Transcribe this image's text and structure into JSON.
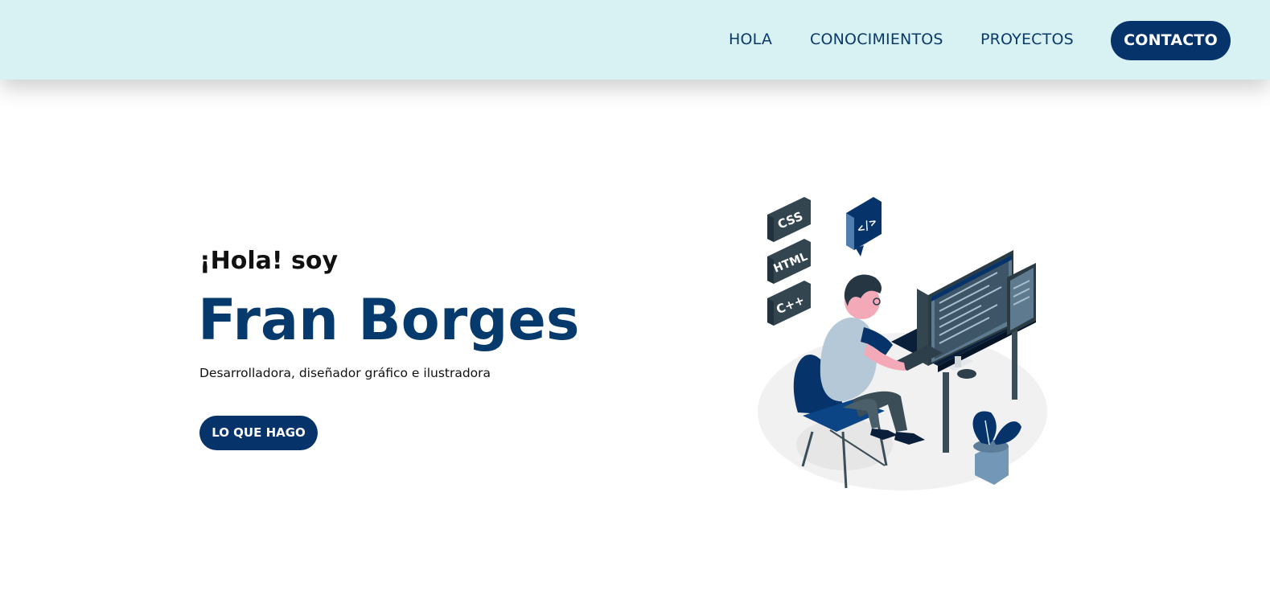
{
  "nav": {
    "links": [
      "HOLA",
      "CONOCIMIENTOS",
      "PROYECTOS"
    ],
    "contact_label": "CONTACTO"
  },
  "hero": {
    "greeting": "¡Hola! soy",
    "name": "Fran Borges",
    "subtitle": "Desarrolladora, diseñador gráfico e ilustradora",
    "cta_label": "LO QUE HAGO",
    "illustration": {
      "tags": [
        "CSS",
        "HTML",
        "C++"
      ],
      "code_bubble": "</>"
    }
  },
  "colors": {
    "nav_bg": "#d8f2f3",
    "primary": "#06336a",
    "text_dark": "#111111"
  }
}
